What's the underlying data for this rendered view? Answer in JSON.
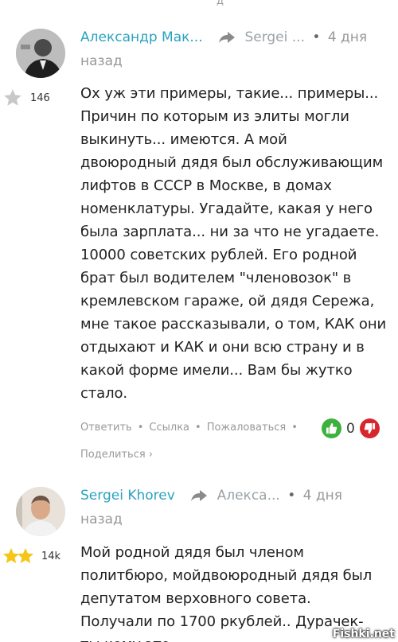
{
  "top_cut_text": "д",
  "comments": [
    {
      "author": "Александр Мак...",
      "reply_to": "Sergei ...",
      "age": "4 дня назад",
      "rating": "146",
      "text": "Ох уж эти примеры, такие... примеры... Причин по которым из элиты могли выкинуть... имеются. А мой двоюродный дядя был обслуживающим лифтов в СССР в Москве, в домах номенклатуры. Угадайте, какая у него была зарплата... ни за что не угадаете. 10000 советских рублей. Его родной брат был водителем \"членовозок\" в кремлевском гараже, ой дядя Сережа, мне такое рассказывали, о том, КАК они отдыхают и КАК и они всю страну и в какой форме имели... Вам бы жутко стало.",
      "actions": {
        "reply": "Ответить",
        "link": "Ссылка",
        "complain": "Пожаловаться",
        "share": "Поделиться ›"
      },
      "votes": "0"
    },
    {
      "author": "Sergei Khorev",
      "reply_to": "Алекса...",
      "age": "4 дня назад",
      "rating": "14k",
      "text": "Мой родной дядя был членом политбюро, мойдвоюродный дядя был депутатом верховного совета. Получали по 1700 ркублей.. Дурачек- ты кому это"
    }
  ],
  "watermark": "Fishki.net",
  "colors": {
    "author": "#2aa3bf",
    "vote_up": "#3cb23c",
    "vote_down": "#d8262d",
    "star_gold": "#f5c518",
    "star_grey": "#c8c8c8"
  }
}
